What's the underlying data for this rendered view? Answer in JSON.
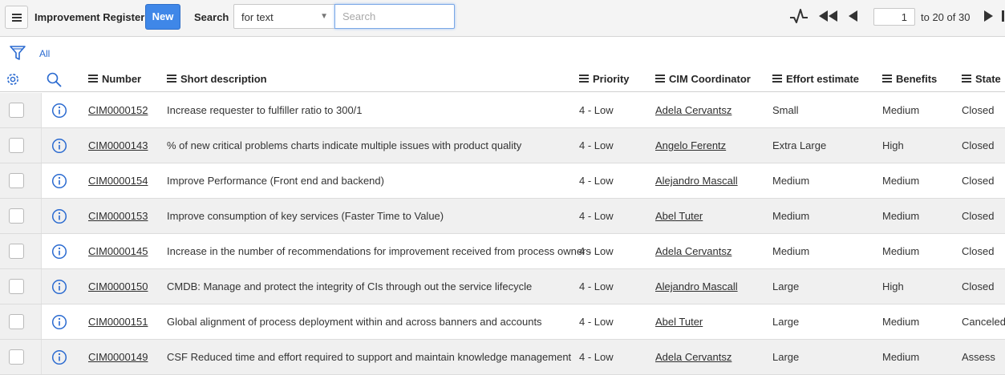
{
  "header": {
    "title": "Improvement Register",
    "new_label": "New",
    "search_label": "Search",
    "search_field": "for text",
    "search_placeholder": "Search",
    "page_value": "1",
    "page_of": "to 20 of 30"
  },
  "filter": {
    "label": "All"
  },
  "columns": [
    "Number",
    "Short description",
    "Priority",
    "CIM Coordinator",
    "Effort estimate",
    "Benefits",
    "State"
  ],
  "rows": [
    {
      "number": "CIM0000152",
      "description": "Increase requester to fulfiller ratio to 300/1",
      "priority": "4 - Low",
      "coordinator": "Adela Cervantsz",
      "effort": "Small",
      "benefits": "Medium",
      "state": "Closed"
    },
    {
      "number": "CIM0000143",
      "description": "% of new critical problems charts indicate multiple issues with product quality",
      "priority": "4 - Low",
      "coordinator": "Angelo Ferentz",
      "effort": "Extra Large",
      "benefits": "High",
      "state": "Closed"
    },
    {
      "number": "CIM0000154",
      "description": "Improve Performance (Front end and backend)",
      "priority": "4 - Low",
      "coordinator": "Alejandro Mascall",
      "effort": "Medium",
      "benefits": "Medium",
      "state": "Closed"
    },
    {
      "number": "CIM0000153",
      "description": "Improve consumption of key services (Faster Time to Value)",
      "priority": "4 - Low",
      "coordinator": "Abel Tuter",
      "effort": "Medium",
      "benefits": "Medium",
      "state": "Closed"
    },
    {
      "number": "CIM0000145",
      "description": "Increase in the number of recommendations for improvement received from process owners",
      "priority": "4 - Low",
      "coordinator": "Adela Cervantsz",
      "effort": "Medium",
      "benefits": "Medium",
      "state": "Closed"
    },
    {
      "number": "CIM0000150",
      "description": "CMDB: Manage and protect the integrity of CIs through out the service lifecycle",
      "priority": "4 - Low",
      "coordinator": "Alejandro Mascall",
      "effort": "Large",
      "benefits": "High",
      "state": "Closed"
    },
    {
      "number": "CIM0000151",
      "description": "Global alignment of process deployment within and across banners and accounts",
      "priority": "4 - Low",
      "coordinator": "Abel Tuter",
      "effort": "Large",
      "benefits": "Medium",
      "state": "Canceled"
    },
    {
      "number": "CIM0000149",
      "description": "CSF Reduced time and effort required to support and maintain knowledge management",
      "priority": "4 - Low",
      "coordinator": "Adela Cervantsz",
      "effort": "Large",
      "benefits": "Medium",
      "state": "Assess"
    }
  ],
  "icons": {
    "menu": "hamburger-icon",
    "pulse": "activity-icon",
    "first": "first-page-icon",
    "prev": "previous-page-icon",
    "next": "next-page-icon",
    "last": "last-page-icon",
    "filter": "filter-icon",
    "settings": "gear-icon",
    "search": "magnifier-icon",
    "info": "info-icon"
  },
  "colors": {
    "accent": "#3f87e8",
    "link": "#2a6ad0",
    "row_alt": "#f0f0f0"
  }
}
